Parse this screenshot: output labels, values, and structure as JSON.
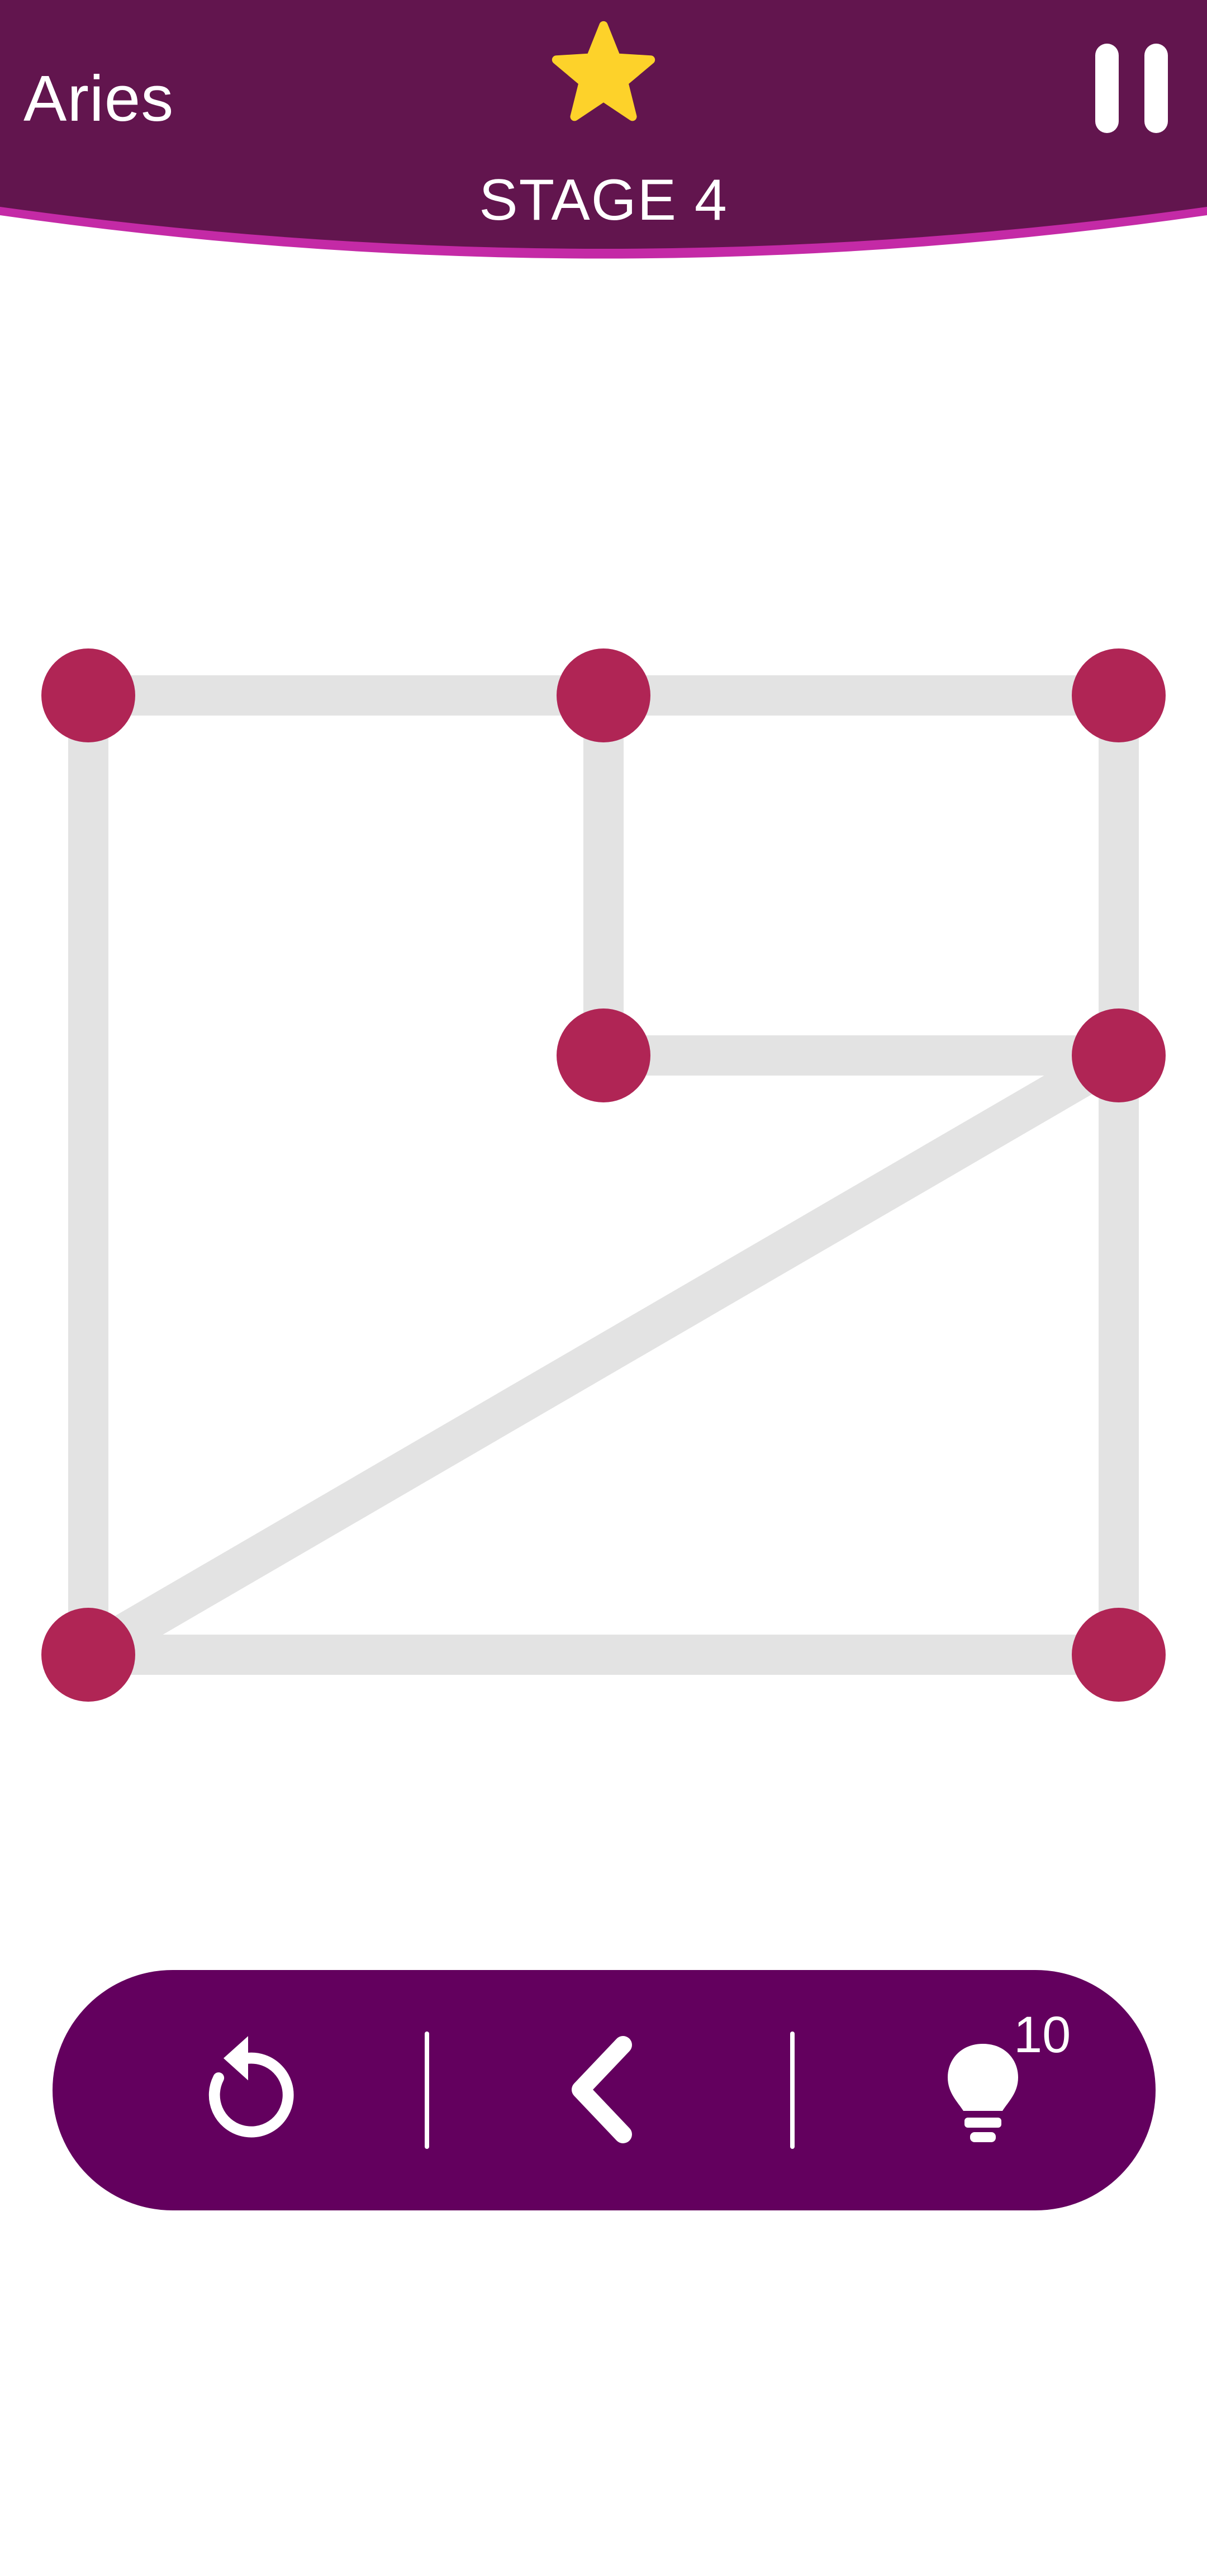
{
  "header": {
    "level_name": "Aries",
    "stage_label": "STAGE 4",
    "star_icon": "star-icon",
    "pause_icon": "pause-icon"
  },
  "colors": {
    "header_bg": "#62154e",
    "header_edge": "#c42aa6",
    "star": "#fdd22a",
    "node": "#b02555",
    "edge": "#e3e3e3",
    "toolbar_bg": "#63005e"
  },
  "toolbar": {
    "undo_icon": "undo-icon",
    "back_icon": "chevron-left-icon",
    "hint_icon": "lightbulb-icon",
    "hint_count": "10"
  }
}
